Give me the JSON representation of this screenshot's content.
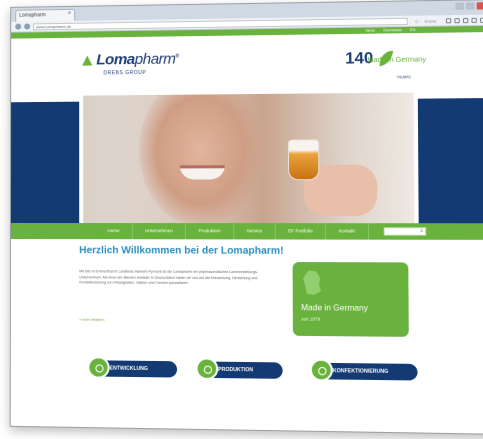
{
  "browser": {
    "tab_title": "Lomapharm",
    "url": "www.lomapharm.de",
    "url_right": "C -   Suche"
  },
  "site": {
    "toplinks": [
      "News",
      "Downloads",
      "EN"
    ],
    "logo": {
      "bold": "Loma",
      "light": "pharm",
      "mark": "®",
      "sub": "DREBS GROUP"
    },
    "anniversary": {
      "number": "140",
      "years": "YEARS",
      "made": "Made in Germany"
    },
    "nav": [
      "Home",
      "Unternehmen",
      "Produktion",
      "Service",
      "EF Portfolio",
      "Kontakt"
    ],
    "welcome": "Herzlich Willkommen bei der Lomapharm!",
    "body_text": "Mit Sitz in Emmerthal im Landkreis Hameln-Pyrmont ist die Lomapharm ein pharmazeutisches Lohnherstellungs-Unternehmen. Als einer der ältesten Anbieter in Deutschland haben wir uns auf die Entwicklung, Herstellung und Konfektionierung von Flüssigkeiten, Salben und Cremes spezialisiert.",
    "more": "» mehr erfahren",
    "made_box": {
      "title": "Made in Germany",
      "since": "seit 1879"
    },
    "bottom_pills": [
      "ENTWICKLUNG",
      "PRODUKTION",
      "KONFEKTIONIERUNG"
    ]
  },
  "colors": {
    "green": "#6ab23e",
    "navy": "#143a73",
    "blue_heading": "#2a8fc0"
  }
}
